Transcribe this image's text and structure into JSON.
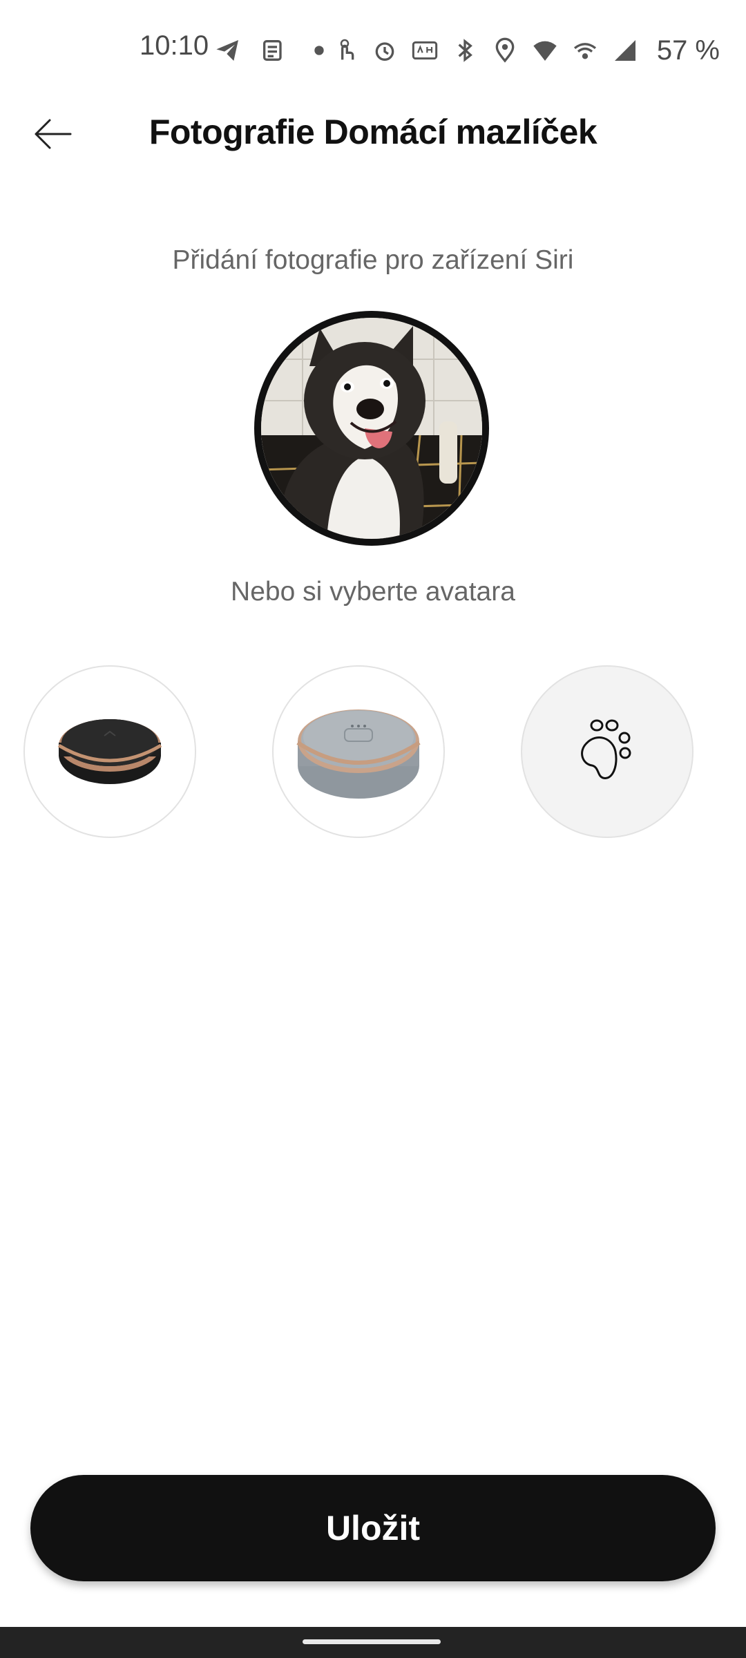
{
  "status_bar": {
    "time": "10:10",
    "battery": "57 %",
    "icons_left": [
      "telegram-icon",
      "news-icon",
      "dot-icon"
    ],
    "icons_right": [
      "touch-icon",
      "alarm-icon",
      "auto-hz-icon",
      "bluetooth-icon",
      "location-icon",
      "wifi-icon",
      "hotspot-icon",
      "signal-icon"
    ]
  },
  "header": {
    "title": "Fotografie Domácí mazlíček",
    "back_icon": "arrow-left-icon"
  },
  "main": {
    "subtitle": "Přidání fotografie pro zařízení Siri",
    "or_label": "Nebo si vyberte avatara",
    "avatars": [
      {
        "name": "black-tracker-avatar",
        "color": "#222222"
      },
      {
        "name": "grey-tracker-avatar",
        "color": "#9aa3ab"
      },
      {
        "name": "paw-avatar",
        "icon": "paw-icon"
      }
    ]
  },
  "footer": {
    "save_label": "Uložit"
  },
  "colors": {
    "primary": "#111111",
    "text_secondary": "#666666",
    "accent_bronze": "#b8876a"
  }
}
